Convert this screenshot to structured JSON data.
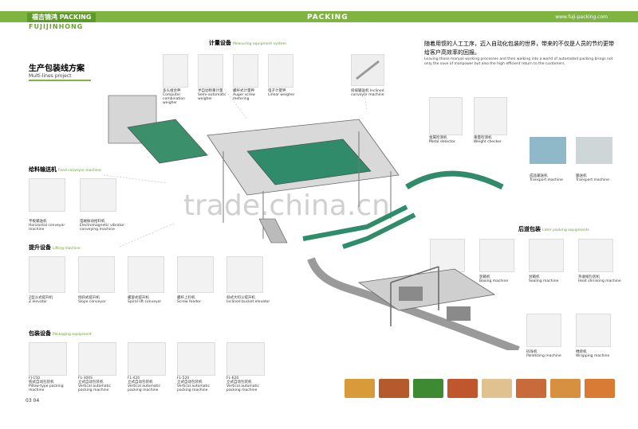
{
  "header": {
    "tab_cn": "福吉锦鸿",
    "tab_en": "PACKING",
    "center": "PACKING",
    "url": "www.fuji-packing.com",
    "brand": "FUJIJINHONG"
  },
  "title": {
    "cn": "生产包装线方案",
    "en": "Multi-lines project"
  },
  "intro": {
    "cn": "随着用惯的人工工序，迈入自动化包装的世界，带来的不仅是人员的节约更带给客户高效率的回报。",
    "en": "Leaving those manual working processes and then walking into a world of automated packing brings not only the save of manpower but also the high efficient return to the customers."
  },
  "sections": {
    "weighing": {
      "cn": "计量设备",
      "en": "Measuring equipment system"
    },
    "feeding": {
      "cn": "给料输送机",
      "en": "Feed conveyor machine"
    },
    "lifting": {
      "cn": "提升设备",
      "en": "Lifting machine"
    },
    "packing": {
      "cn": "包装设备",
      "en": "Packaging equipment"
    },
    "later": {
      "cn": "后道包装",
      "en": "Later packing equipments"
    }
  },
  "weighing_items": [
    {
      "label": "多头组合秤",
      "en": "Computer combination weigher"
    },
    {
      "label": "半自动称重计量",
      "en": "Semi-automatic weigher"
    },
    {
      "label": "螺杆式计量秤",
      "en": "Auger screw metering"
    },
    {
      "label": "电子计量秤",
      "en": "Linear weigher"
    }
  ],
  "wash_item": {
    "label": "斜坡输送机",
    "en": "Inclined conveyor machine"
  },
  "feeding_items": [
    {
      "label": "平板输送机",
      "en": "Horizontal conveyor machine"
    },
    {
      "label": "电磁振动给料机",
      "en": "Electromagnetic vibrator conveying machine"
    }
  ],
  "lifting_items": [
    {
      "label": "Z型斗式提升机",
      "en": "Z elevator"
    },
    {
      "label": "倾斜式提升机",
      "en": "Slope conveyor"
    },
    {
      "label": "螺旋式提升机",
      "en": "Spiral lift conveyor"
    },
    {
      "label": "螺杆上料机",
      "en": "Screw feeder"
    },
    {
      "label": "斜式大料斗提升机",
      "en": "Inclined bucket elevator"
    }
  ],
  "packing_items": [
    {
      "model": "FJ-150",
      "label": "枕式自动包装机",
      "en": "Pillow-type packing machine"
    },
    {
      "model": "FL-300S",
      "label": "立式自动包装机",
      "en": "Vertical automatic packing machine"
    },
    {
      "model": "FL-420",
      "label": "立式自动包装机",
      "en": "Vertical automatic packing machine"
    },
    {
      "model": "FL-520",
      "label": "立式自动包装机",
      "en": "Vertical automatic packing machine"
    },
    {
      "model": "FL-620",
      "label": "立式自动包装机",
      "en": "Vertical automatic packing machine"
    }
  ],
  "inspection_items": [
    {
      "label": "金属检测机",
      "en": "Metal detector"
    },
    {
      "label": "重量检测机",
      "en": "Weight checker"
    }
  ],
  "conveyor_items": [
    {
      "label": "成品输送机",
      "en": "Transport machine"
    },
    {
      "label": "输送机",
      "en": "Transport machine"
    }
  ],
  "later_items": [
    {
      "label": "开箱机",
      "en": "Box opening machine"
    },
    {
      "label": "装箱机",
      "en": "Boxing machine"
    },
    {
      "label": "封箱机",
      "en": "Sealing machine"
    },
    {
      "label": "热收缩包装机",
      "en": "Heat shrinking machine"
    }
  ],
  "later_items2": [
    {
      "label": "码垛机",
      "en": "Palletizing machine"
    },
    {
      "label": "缠绕机",
      "en": "Wrapping machine"
    }
  ],
  "watermark": "trade.china.cn",
  "pages": "03 04"
}
